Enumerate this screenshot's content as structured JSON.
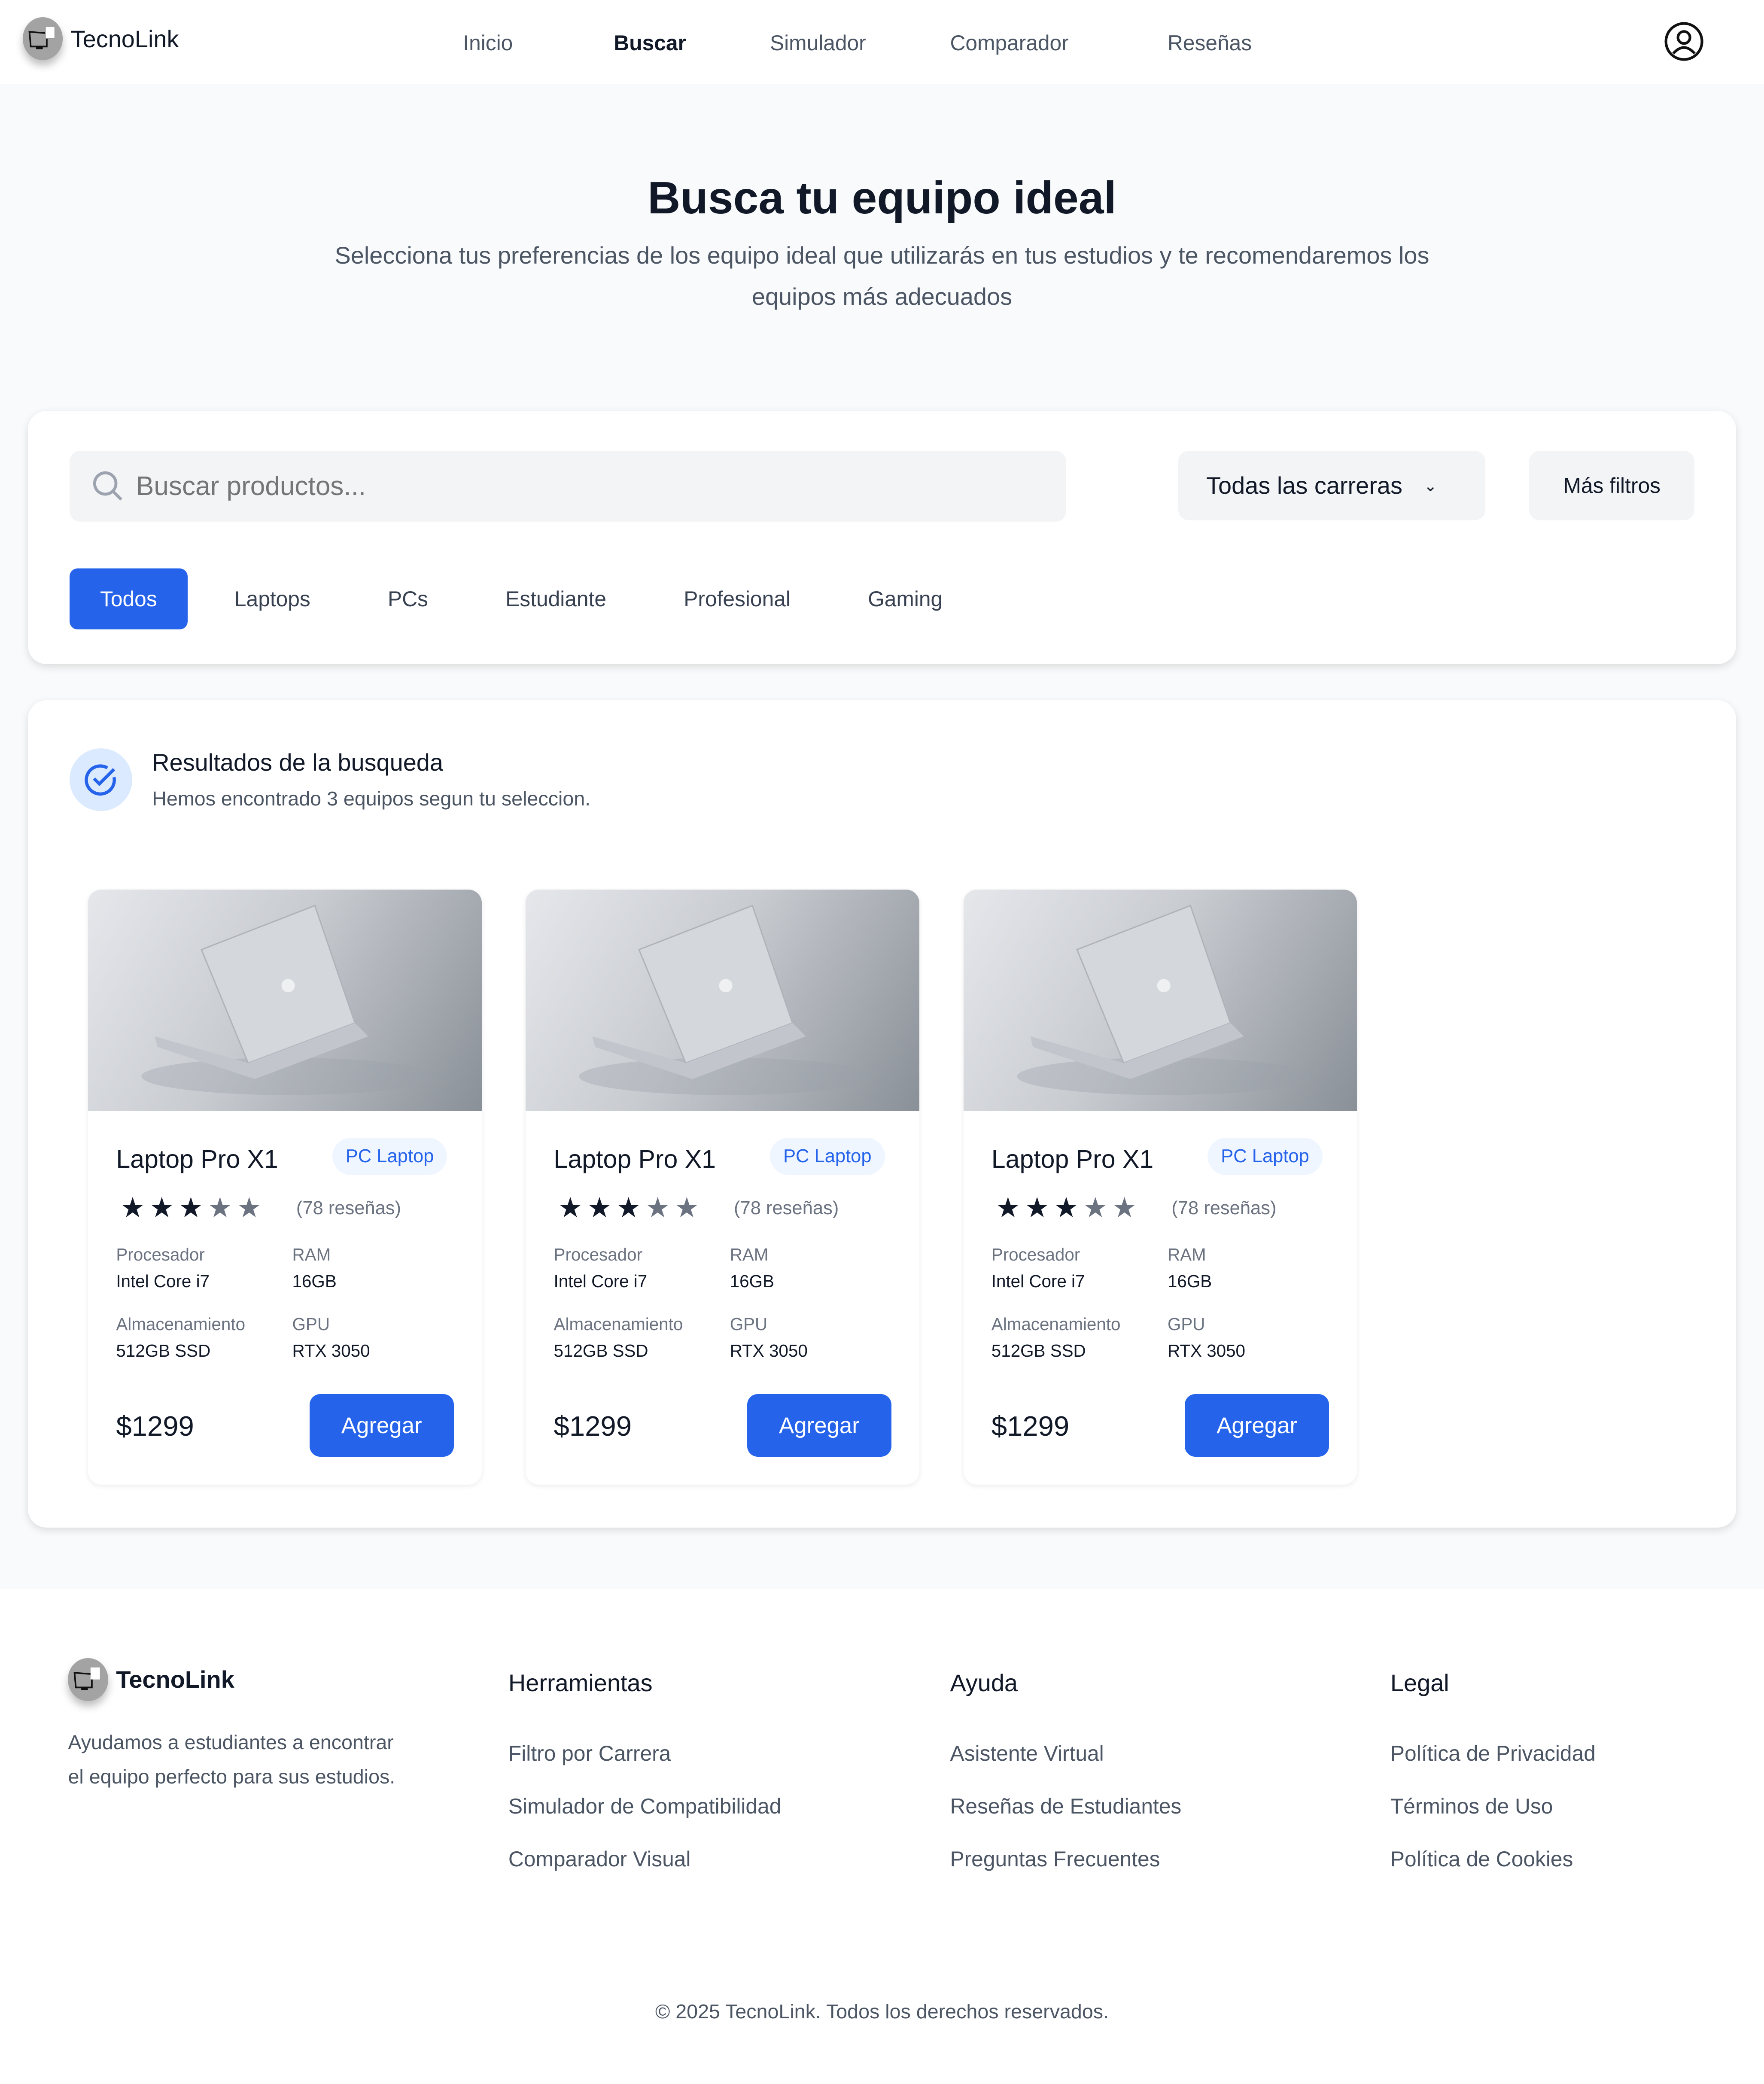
{
  "brand": "TecnoLink",
  "nav": {
    "items": [
      "Inicio",
      "Buscar",
      "Simulador",
      "Comparador",
      "Reseñas"
    ],
    "active": "Buscar"
  },
  "hero": {
    "title": "Busca tu equipo ideal",
    "subtitle": "Selecciona tus preferencias de los equipo ideal que utilizarás en tus estudios y te recomendaremos los equipos más adecuados"
  },
  "filters": {
    "search_placeholder": "Buscar productos...",
    "career_select": "Todas las carreras",
    "more_filters": "Más filtros",
    "tabs": [
      "Todos",
      "Laptops",
      "PCs",
      "Estudiante",
      "Profesional",
      "Gaming"
    ],
    "active_tab": "Todos"
  },
  "results": {
    "title": "Resultados de la busqueda",
    "subtitle": "Hemos encontrado 3 equipos segun tu seleccion.",
    "products": [
      {
        "name": "Laptop Pro X1",
        "badge": "PC Laptop",
        "rating": 3,
        "reviews": "(78 reseñas)",
        "specs": [
          {
            "label": "Procesador",
            "value": "Intel Core i7"
          },
          {
            "label": "RAM",
            "value": "16GB"
          },
          {
            "label": "Almacenamiento",
            "value": "512GB SSD"
          },
          {
            "label": "GPU",
            "value": "RTX 3050"
          }
        ],
        "price": "$1299",
        "button": "Agregar"
      },
      {
        "name": "Laptop Pro X1",
        "badge": "PC Laptop",
        "rating": 3,
        "reviews": "(78 reseñas)",
        "specs": [
          {
            "label": "Procesador",
            "value": "Intel Core i7"
          },
          {
            "label": "RAM",
            "value": "16GB"
          },
          {
            "label": "Almacenamiento",
            "value": "512GB SSD"
          },
          {
            "label": "GPU",
            "value": "RTX 3050"
          }
        ],
        "price": "$1299",
        "button": "Agregar"
      },
      {
        "name": "Laptop Pro X1",
        "badge": "PC Laptop",
        "rating": 3,
        "reviews": "(78 reseñas)",
        "specs": [
          {
            "label": "Procesador",
            "value": "Intel Core i7"
          },
          {
            "label": "RAM",
            "value": "16GB"
          },
          {
            "label": "Almacenamiento",
            "value": "512GB SSD"
          },
          {
            "label": "GPU",
            "value": "RTX 3050"
          }
        ],
        "price": "$1299",
        "button": "Agregar"
      }
    ]
  },
  "footer": {
    "about": "Ayudamos a estudiantes a encontrar el equipo perfecto para sus estudios.",
    "columns": [
      {
        "title": "Herramientas",
        "links": [
          "Filtro por Carrera",
          "Simulador de Compatibilidad",
          "Comparador Visual"
        ]
      },
      {
        "title": "Ayuda",
        "links": [
          "Asistente Virtual",
          "Reseñas de Estudiantes",
          "Preguntas Frecuentes"
        ]
      },
      {
        "title": "Legal",
        "links": [
          "Política de Privacidad",
          "Términos de Uso",
          "Política de Cookies"
        ]
      }
    ],
    "copyright": "© 2025 TecnoLink. Todos los derechos reservados."
  },
  "colors": {
    "primary": "#2563eb",
    "background": "#f9fafb",
    "text": "#111827"
  }
}
